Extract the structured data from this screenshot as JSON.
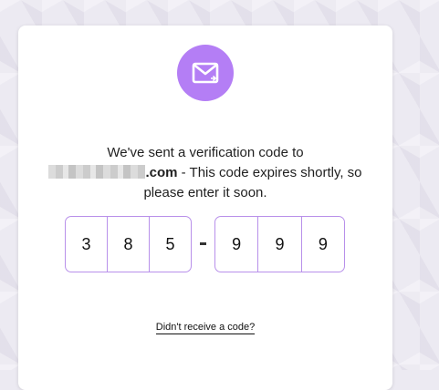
{
  "icon": {
    "name": "mail-icon",
    "color": "#b47ef5"
  },
  "message": {
    "line1": "We've sent a verification code to",
    "email_domain": ".com",
    "line2_rest": " - This code expires shortly, so",
    "line3": "please enter it soon."
  },
  "code": {
    "first": [
      "3",
      "8",
      "5"
    ],
    "second": [
      "9",
      "9",
      "9"
    ]
  },
  "resend_link": "Didn't receive a code?",
  "colors": {
    "accent": "#b47ef5",
    "border": "#b890ea"
  }
}
